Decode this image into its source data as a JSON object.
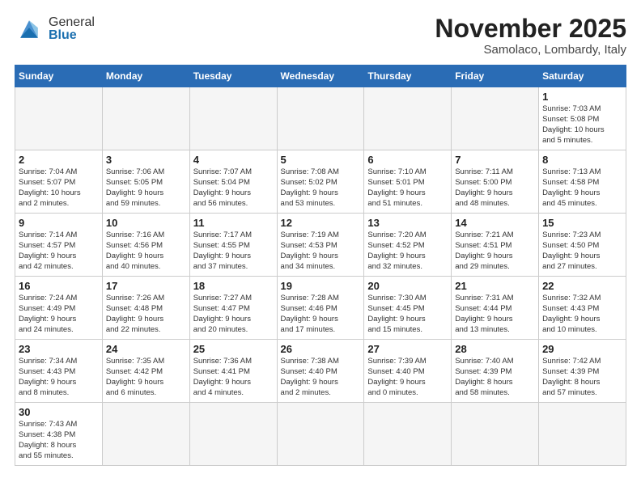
{
  "logo": {
    "general": "General",
    "blue": "Blue"
  },
  "title": "November 2025",
  "location": "Samolaco, Lombardy, Italy",
  "weekdays": [
    "Sunday",
    "Monday",
    "Tuesday",
    "Wednesday",
    "Thursday",
    "Friday",
    "Saturday"
  ],
  "weeks": [
    [
      {
        "day": "",
        "info": "",
        "empty": true
      },
      {
        "day": "",
        "info": "",
        "empty": true
      },
      {
        "day": "",
        "info": "",
        "empty": true
      },
      {
        "day": "",
        "info": "",
        "empty": true
      },
      {
        "day": "",
        "info": "",
        "empty": true
      },
      {
        "day": "",
        "info": "",
        "empty": true
      },
      {
        "day": "1",
        "info": "Sunrise: 7:03 AM\nSunset: 5:08 PM\nDaylight: 10 hours\nand 5 minutes."
      }
    ],
    [
      {
        "day": "2",
        "info": "Sunrise: 7:04 AM\nSunset: 5:07 PM\nDaylight: 10 hours\nand 2 minutes."
      },
      {
        "day": "3",
        "info": "Sunrise: 7:06 AM\nSunset: 5:05 PM\nDaylight: 9 hours\nand 59 minutes."
      },
      {
        "day": "4",
        "info": "Sunrise: 7:07 AM\nSunset: 5:04 PM\nDaylight: 9 hours\nand 56 minutes."
      },
      {
        "day": "5",
        "info": "Sunrise: 7:08 AM\nSunset: 5:02 PM\nDaylight: 9 hours\nand 53 minutes."
      },
      {
        "day": "6",
        "info": "Sunrise: 7:10 AM\nSunset: 5:01 PM\nDaylight: 9 hours\nand 51 minutes."
      },
      {
        "day": "7",
        "info": "Sunrise: 7:11 AM\nSunset: 5:00 PM\nDaylight: 9 hours\nand 48 minutes."
      },
      {
        "day": "8",
        "info": "Sunrise: 7:13 AM\nSunset: 4:58 PM\nDaylight: 9 hours\nand 45 minutes."
      }
    ],
    [
      {
        "day": "9",
        "info": "Sunrise: 7:14 AM\nSunset: 4:57 PM\nDaylight: 9 hours\nand 42 minutes."
      },
      {
        "day": "10",
        "info": "Sunrise: 7:16 AM\nSunset: 4:56 PM\nDaylight: 9 hours\nand 40 minutes."
      },
      {
        "day": "11",
        "info": "Sunrise: 7:17 AM\nSunset: 4:55 PM\nDaylight: 9 hours\nand 37 minutes."
      },
      {
        "day": "12",
        "info": "Sunrise: 7:19 AM\nSunset: 4:53 PM\nDaylight: 9 hours\nand 34 minutes."
      },
      {
        "day": "13",
        "info": "Sunrise: 7:20 AM\nSunset: 4:52 PM\nDaylight: 9 hours\nand 32 minutes."
      },
      {
        "day": "14",
        "info": "Sunrise: 7:21 AM\nSunset: 4:51 PM\nDaylight: 9 hours\nand 29 minutes."
      },
      {
        "day": "15",
        "info": "Sunrise: 7:23 AM\nSunset: 4:50 PM\nDaylight: 9 hours\nand 27 minutes."
      }
    ],
    [
      {
        "day": "16",
        "info": "Sunrise: 7:24 AM\nSunset: 4:49 PM\nDaylight: 9 hours\nand 24 minutes."
      },
      {
        "day": "17",
        "info": "Sunrise: 7:26 AM\nSunset: 4:48 PM\nDaylight: 9 hours\nand 22 minutes."
      },
      {
        "day": "18",
        "info": "Sunrise: 7:27 AM\nSunset: 4:47 PM\nDaylight: 9 hours\nand 20 minutes."
      },
      {
        "day": "19",
        "info": "Sunrise: 7:28 AM\nSunset: 4:46 PM\nDaylight: 9 hours\nand 17 minutes."
      },
      {
        "day": "20",
        "info": "Sunrise: 7:30 AM\nSunset: 4:45 PM\nDaylight: 9 hours\nand 15 minutes."
      },
      {
        "day": "21",
        "info": "Sunrise: 7:31 AM\nSunset: 4:44 PM\nDaylight: 9 hours\nand 13 minutes."
      },
      {
        "day": "22",
        "info": "Sunrise: 7:32 AM\nSunset: 4:43 PM\nDaylight: 9 hours\nand 10 minutes."
      }
    ],
    [
      {
        "day": "23",
        "info": "Sunrise: 7:34 AM\nSunset: 4:43 PM\nDaylight: 9 hours\nand 8 minutes."
      },
      {
        "day": "24",
        "info": "Sunrise: 7:35 AM\nSunset: 4:42 PM\nDaylight: 9 hours\nand 6 minutes."
      },
      {
        "day": "25",
        "info": "Sunrise: 7:36 AM\nSunset: 4:41 PM\nDaylight: 9 hours\nand 4 minutes."
      },
      {
        "day": "26",
        "info": "Sunrise: 7:38 AM\nSunset: 4:40 PM\nDaylight: 9 hours\nand 2 minutes."
      },
      {
        "day": "27",
        "info": "Sunrise: 7:39 AM\nSunset: 4:40 PM\nDaylight: 9 hours\nand 0 minutes."
      },
      {
        "day": "28",
        "info": "Sunrise: 7:40 AM\nSunset: 4:39 PM\nDaylight: 8 hours\nand 58 minutes."
      },
      {
        "day": "29",
        "info": "Sunrise: 7:42 AM\nSunset: 4:39 PM\nDaylight: 8 hours\nand 57 minutes."
      }
    ],
    [
      {
        "day": "30",
        "info": "Sunrise: 7:43 AM\nSunset: 4:38 PM\nDaylight: 8 hours\nand 55 minutes."
      },
      {
        "day": "",
        "info": "",
        "empty": true
      },
      {
        "day": "",
        "info": "",
        "empty": true
      },
      {
        "day": "",
        "info": "",
        "empty": true
      },
      {
        "day": "",
        "info": "",
        "empty": true
      },
      {
        "day": "",
        "info": "",
        "empty": true
      },
      {
        "day": "",
        "info": "",
        "empty": true
      }
    ]
  ]
}
